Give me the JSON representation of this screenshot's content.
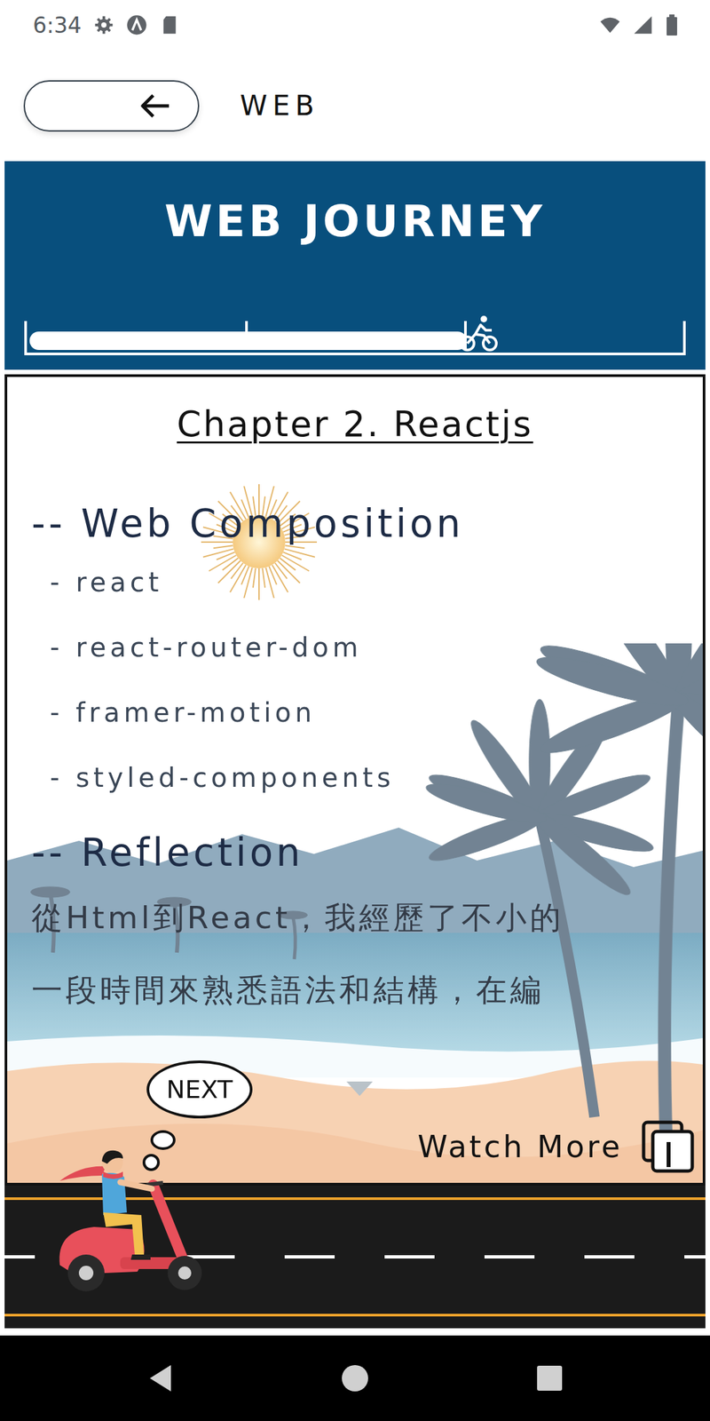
{
  "status_bar": {
    "time": "6:34"
  },
  "top_bar": {
    "title": "WEB"
  },
  "banner": {
    "title": "WEB JOURNEY",
    "progress": {
      "level": 0.666
    }
  },
  "chapter": {
    "title": "Chapter 2. Reactjs",
    "sections": [
      {
        "heading": "-- Web Composition",
        "kind": "list",
        "items": [
          "- react",
          "- react-router-dom",
          "- framer-motion",
          "- styled-components"
        ]
      },
      {
        "heading": "-- Reflection",
        "kind": "paragraph",
        "lines": [
          "從Html到React，我經歷了不小的",
          "一段時間來熟悉語法和結構，在編"
        ]
      }
    ]
  },
  "next_button": {
    "label": "NEXT"
  },
  "watch_more": {
    "label": "Watch More"
  }
}
